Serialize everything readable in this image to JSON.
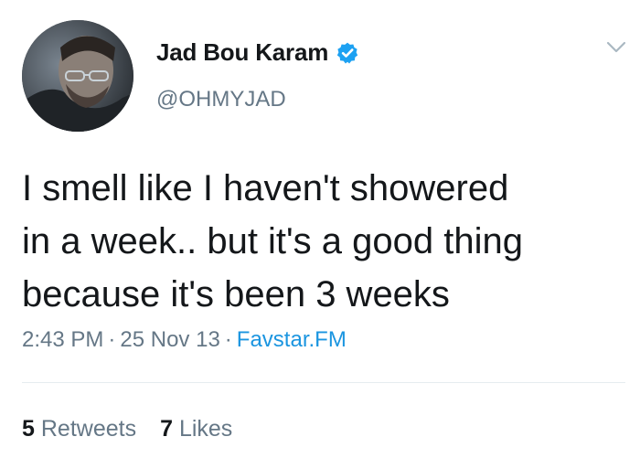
{
  "user": {
    "display_name": "Jad Bou Karam",
    "handle": "@OHMYJAD",
    "verified": true,
    "avatar_icon": "profile-photo"
  },
  "tweet": {
    "text_lines": [
      "I smell like I haven't showered",
      "in a week.. but it's a good thing",
      "because it's been 3 weeks"
    ],
    "time": "2:43 PM",
    "date": "25 Nov 13",
    "separator": "·",
    "source": "Favstar.FM"
  },
  "stats": {
    "retweets_count": "5",
    "retweets_label": "Retweets",
    "likes_count": "7",
    "likes_label": "Likes"
  },
  "colors": {
    "text": "#14171a",
    "secondary": "#657786",
    "link": "#1b95e0",
    "verified": "#1da1f2",
    "divider": "#e6ecf0"
  },
  "icons": {
    "verified": "verified-badge-icon",
    "menu": "chevron-down-icon"
  }
}
